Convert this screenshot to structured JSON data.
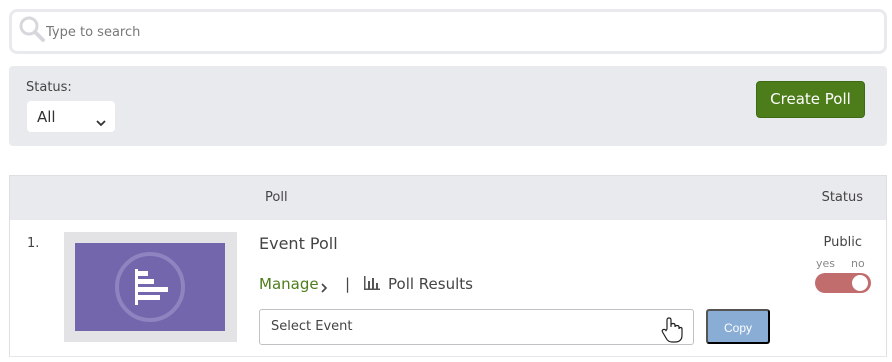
{
  "search": {
    "placeholder": "Type to search",
    "icon": "search-icon"
  },
  "filters": {
    "status_label": "Status:",
    "status_value": "All"
  },
  "toolbar": {
    "create_poll_label": "Create Poll"
  },
  "table": {
    "columns": [
      "Poll",
      "Status"
    ],
    "rows": [
      {
        "index": "1.",
        "title": "Event Poll",
        "manage_label": "Manage",
        "separator": "|",
        "results_label": "Poll Results",
        "event_select_value": "Select Event",
        "copy_label": "Copy",
        "visibility": "Public",
        "toggle_yes": "yes",
        "toggle_no": "no",
        "public_enabled": true
      }
    ]
  },
  "colors": {
    "accent_green": "#4d7d1b",
    "copy_blue": "#89add5",
    "toggle_red": "#c16d6d",
    "thumbnail_purple": "#7466ad",
    "panel_gray": "#e9eaed"
  },
  "icons": {
    "search": "search-icon",
    "chevron": "chevron-down-icon",
    "manage": "chevron-right-icon",
    "results": "bar-chart-icon",
    "thumbnail": "poll-chart-icon",
    "cursor": "hand-cursor-icon"
  }
}
